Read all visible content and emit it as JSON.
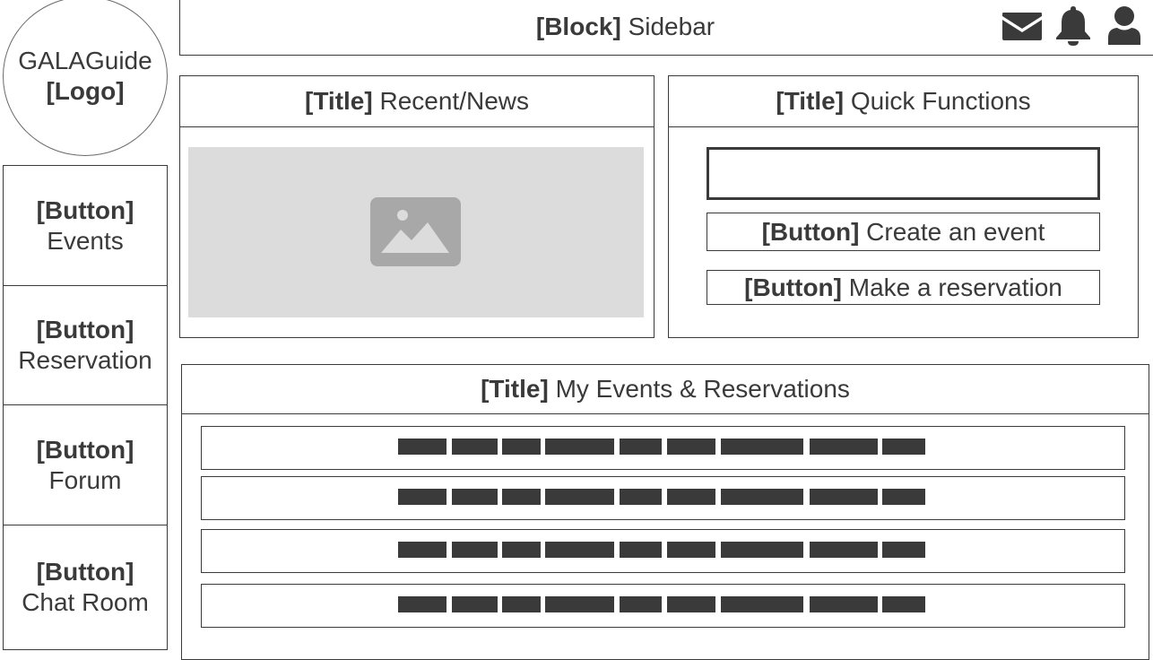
{
  "logo": {
    "name": "GALAGuide",
    "tag": "[Logo]"
  },
  "header": {
    "tag": "[Block]",
    "text": "Sidebar"
  },
  "header_icons": [
    "envelope-icon",
    "bell-icon",
    "user-icon"
  ],
  "sidebar": {
    "items": [
      {
        "tag": "[Button]",
        "label": "Events"
      },
      {
        "tag": "[Button]",
        "label": "Reservation"
      },
      {
        "tag": "[Button]",
        "label": "Forum"
      },
      {
        "tag": "[Button]",
        "label": "Chat Room"
      }
    ]
  },
  "recent": {
    "tag": "[Title]",
    "title": "Recent/News",
    "image": "image-placeholder-icon"
  },
  "quick": {
    "tag": "[Title]",
    "title": "Quick Functions",
    "input_value": "",
    "buttons": [
      {
        "tag": "[Button]",
        "label": "Create an event"
      },
      {
        "tag": "[Button]",
        "label": "Make a reservation"
      }
    ]
  },
  "my_events": {
    "tag": "[Title]",
    "title": "My Events & Reservations",
    "row_count": 4
  },
  "colors": {
    "ink": "#3a3a3a",
    "placeholder_bg": "#dcdcdc",
    "placeholder_icon": "#a8a8a8"
  }
}
